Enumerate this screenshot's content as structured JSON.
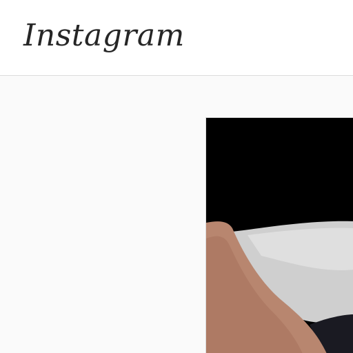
{
  "header": {
    "logo_text": "Instagram"
  },
  "post": {
    "media_icon": "post-photo"
  },
  "colors": {
    "header_bg": "#ffffff",
    "page_bg": "#fafafa",
    "divider": "#dbdbdb",
    "logo_text": "#262626"
  }
}
